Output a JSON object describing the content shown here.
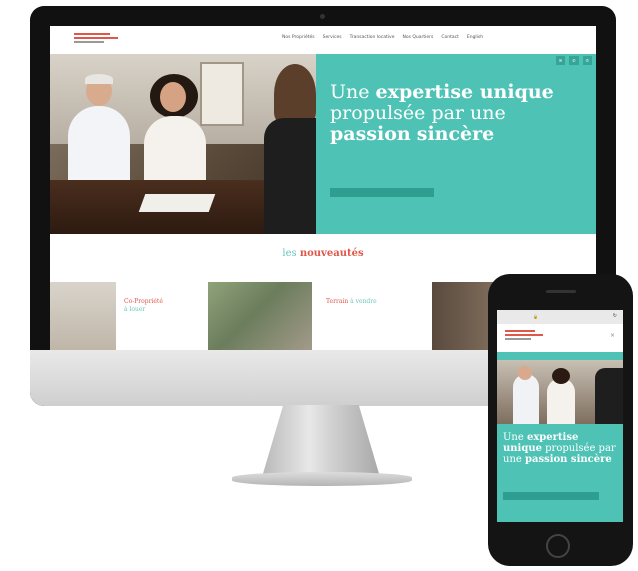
{
  "colors": {
    "teal": "#4ec3b5",
    "coral": "#e0574a",
    "dark_teal": "#2f9e90"
  },
  "desktop": {
    "nav": [
      "Nos Propriétés",
      "Services",
      "Transaction locative",
      "Nos Quartiers",
      "Contact",
      "English"
    ],
    "hero": {
      "title_plain_1": "Une ",
      "title_bold_1": "expertise unique",
      "title_plain_2": " propulsée par une ",
      "title_bold_2": "passion",
      "title_bold_3": "sincère"
    },
    "section": {
      "title_light": "les ",
      "title_bold": "nouveautés"
    },
    "cards": {
      "card1_title": "Co-Propriété",
      "card1_sub": "à louer",
      "card2_title": "Terrain",
      "card2_sub": " à vendre"
    }
  },
  "mobile": {
    "title_plain_1": "Une ",
    "title_bold_1": "expertise unique",
    "title_plain_2": " propulsée par une ",
    "title_bold_2": "passion sincère"
  }
}
